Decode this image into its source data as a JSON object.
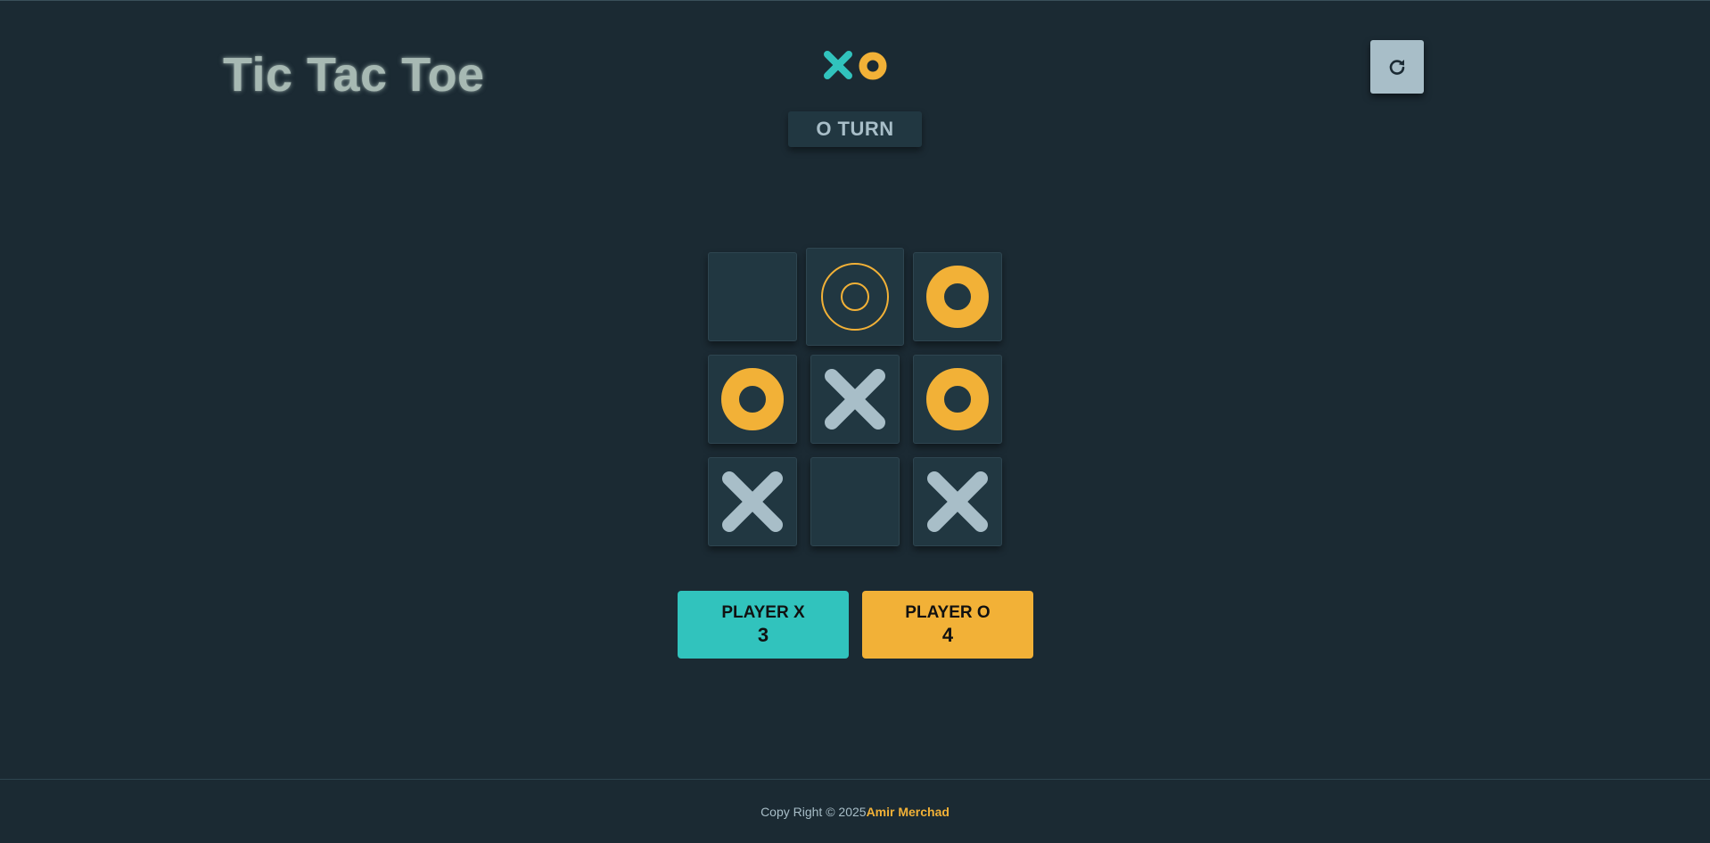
{
  "header": {
    "title": "Tic Tac Toe",
    "turn_text": "O TURN",
    "reset_icon": "restart-icon"
  },
  "logo": {
    "icons": [
      "x-mark-icon",
      "o-mark-icon"
    ]
  },
  "board": {
    "cells": [
      "",
      "O-outline",
      "O",
      "O",
      "X",
      "O",
      "X",
      "",
      "X"
    ],
    "hovered_cell": 1
  },
  "scores": {
    "x": {
      "label": "PLAYER X",
      "value": "3"
    },
    "o": {
      "label": "PLAYER O",
      "value": "4"
    }
  },
  "footer": {
    "copyright": "Copy Right © 2025",
    "author": "Amir Merchad"
  },
  "colors": {
    "background": "#1b2a33",
    "cell": "#213741",
    "x_accent": "#31c3bd",
    "o_accent": "#f2b137",
    "silver": "#a8bec8"
  }
}
